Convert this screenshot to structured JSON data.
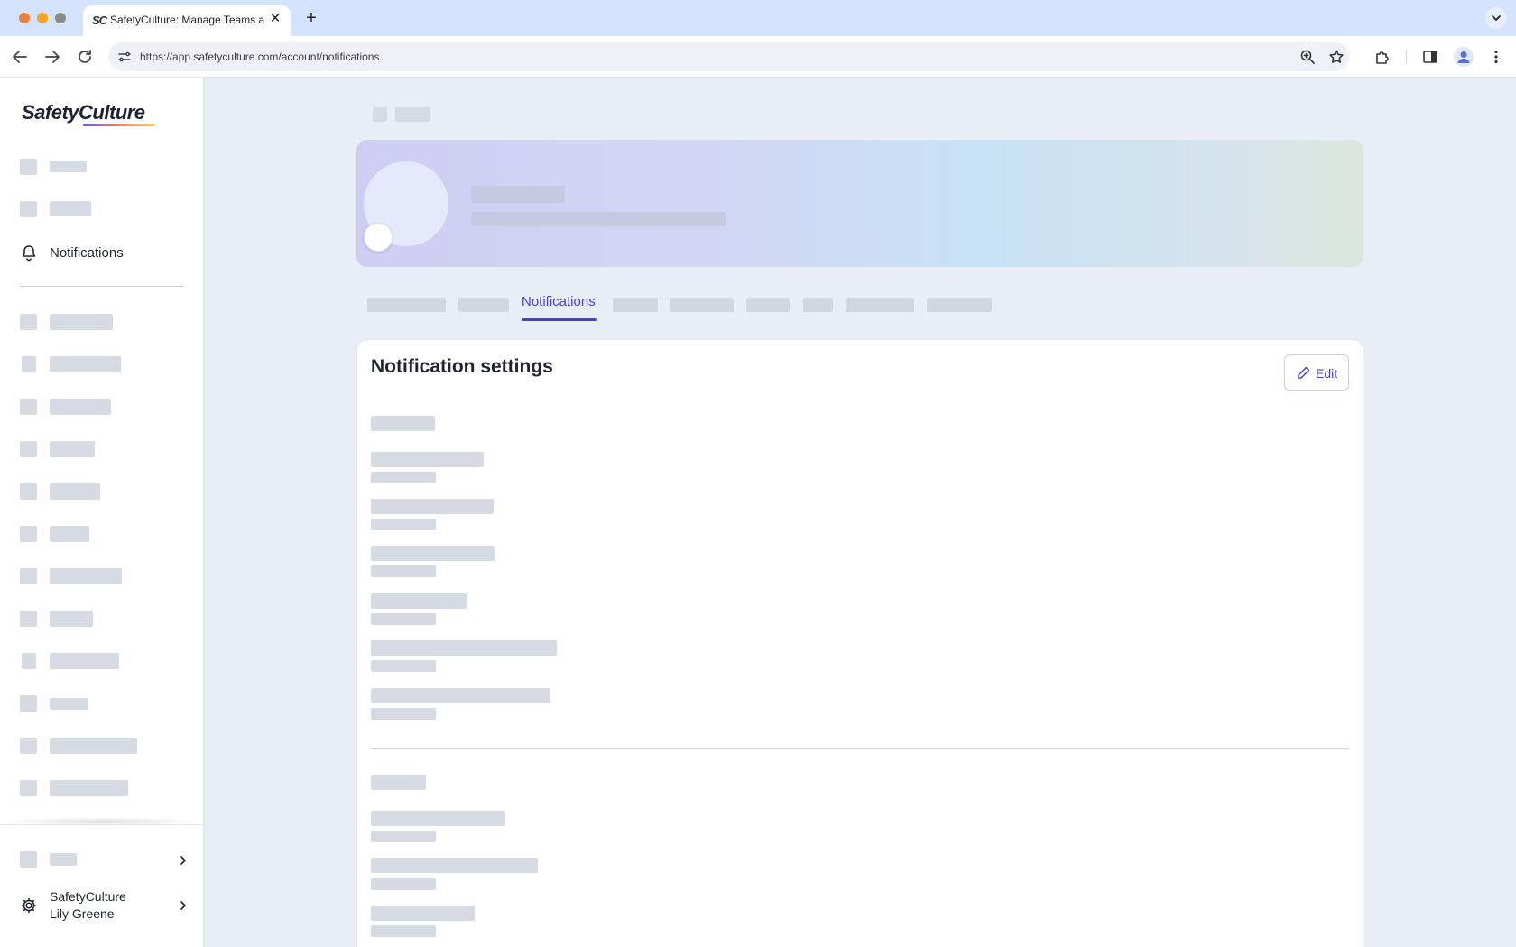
{
  "browser": {
    "tab_title": "SafetyCulture: Manage Teams and...",
    "tab_favicon": "SC",
    "url": "https://app.safetyculture.com/account/notifications"
  },
  "sidebar": {
    "logo": "SafetyCulture",
    "notifications_label": "Notifications",
    "org_name": "SafetyCulture",
    "user_name": "Lily Greene"
  },
  "main": {
    "active_tab": "Notifications",
    "card_title": "Notification settings",
    "edit_label": "Edit"
  },
  "colors": {
    "accent": "#4740d4"
  }
}
